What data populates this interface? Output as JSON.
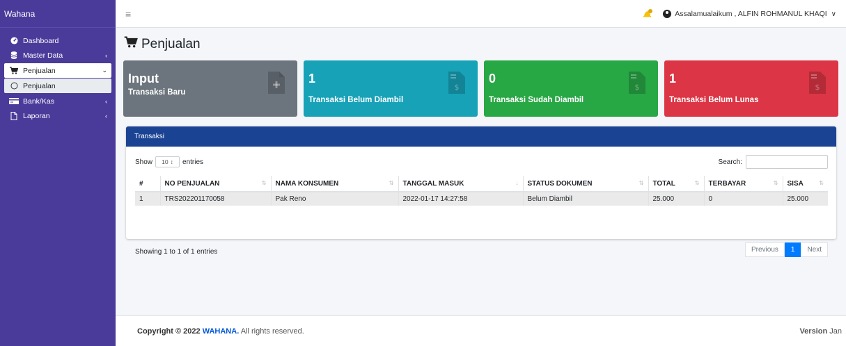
{
  "sidebar": {
    "brand": "Wahana",
    "items": [
      {
        "label": "Dashboard"
      },
      {
        "label": "Master Data"
      },
      {
        "label": "Penjualan"
      },
      {
        "label": "Penjualan"
      },
      {
        "label": "Bank/Kas"
      },
      {
        "label": "Laporan"
      }
    ]
  },
  "topbar": {
    "greeting": "Assalamualaikum , ALFIN ROHMANUL KHAQI"
  },
  "page": {
    "title": "Penjualan"
  },
  "boxes": [
    {
      "num": "Input",
      "label": "Transaksi Baru",
      "color": "#6c757d"
    },
    {
      "num": "1",
      "label": "Transaksi Belum Diambil",
      "color": "#17a2b8"
    },
    {
      "num": "0",
      "label": "Transaksi Sudah Diambil",
      "color": "#28a745"
    },
    {
      "num": "1",
      "label": "Transaksi Belum Lunas",
      "color": "#dc3545"
    }
  ],
  "card": {
    "title": "Transaksi",
    "show_label": "Show",
    "entries_value": "10",
    "entries_label": "entries",
    "search_label": "Search:",
    "search_value": "",
    "columns": [
      "#",
      "NO PENJUALAN",
      "NAMA KONSUMEN",
      "TANGGAL MASUK",
      "STATUS DOKUMEN",
      "TOTAL",
      "TERBAYAR",
      "SISA"
    ],
    "rows": [
      [
        "1",
        "TRS202201170058",
        "Pak Reno",
        "2022-01-17 14:27:58",
        "Belum Diambil",
        "25.000",
        "0",
        "25.000"
      ]
    ],
    "info": "Showing 1 to 1 of 1 entries",
    "pager": {
      "previous": "Previous",
      "current": "1",
      "next": "Next"
    }
  },
  "footer": {
    "copyright": "Copyright © 2022",
    "brand": "WAHANA.",
    "rights": "All rights reserved.",
    "version_label": "Version",
    "version_value": "Jan"
  },
  "colors": {
    "sidebar": "#4a3b9a",
    "card_header": "#1b4394",
    "primary": "#007bff"
  }
}
